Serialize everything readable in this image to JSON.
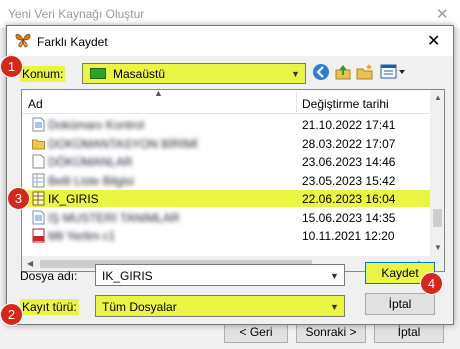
{
  "background_window": {
    "title": "Yeni Veri Kaynağı Oluştur",
    "close": "✕",
    "buttons": {
      "back": "< Geri",
      "next": "Sonraki >",
      "cancel": "İptal"
    }
  },
  "dialog": {
    "title": "Farklı Kaydet",
    "close": "✕",
    "location_label": "Konum:",
    "location_value": "Masaüstü",
    "columns": {
      "name": "Ad",
      "modified": "Değiştirme tarihi"
    },
    "files": [
      {
        "name": "Dokümanı Kontrol",
        "date": "21.10.2022 17:41",
        "icon": "document-icon",
        "blurred": true,
        "selected": false
      },
      {
        "name": "DOKÜMANTASYON BİRİMİ",
        "date": "28.03.2022 17:07",
        "icon": "folder-icon",
        "blurred": true,
        "selected": false
      },
      {
        "name": "DÖKÜMANLAR",
        "date": "23.06.2023 14:46",
        "icon": "file-icon",
        "blurred": true,
        "selected": false
      },
      {
        "name": "Belli Liste Bilgisi",
        "date": "23.05.2023 15:42",
        "icon": "spreadsheet-icon",
        "blurred": true,
        "selected": false
      },
      {
        "name": "IK_GIRIS",
        "date": "22.06.2023 16:04",
        "icon": "table-icon",
        "blurred": false,
        "selected": true
      },
      {
        "name": "İŞ MUSTERİ TANIMLAR",
        "date": "15.06.2023 14:35",
        "icon": "document-icon",
        "blurred": true,
        "selected": false
      },
      {
        "name": "Mil Yerlim c1",
        "date": "10.11.2021 12:20",
        "icon": "pdf-icon",
        "blurred": true,
        "selected": false
      }
    ],
    "filename_label": "Dosya adı:",
    "filename_value": "IK_GIRIS",
    "filetype_label": "Kayıt türü:",
    "filetype_value": "Tüm Dosyalar",
    "save_button": "Kaydet",
    "cancel_button": "İptal"
  },
  "badges": [
    "1",
    "2",
    "3",
    "4"
  ],
  "colors": {
    "highlight": "#e9f542",
    "badge": "#d9261c"
  }
}
